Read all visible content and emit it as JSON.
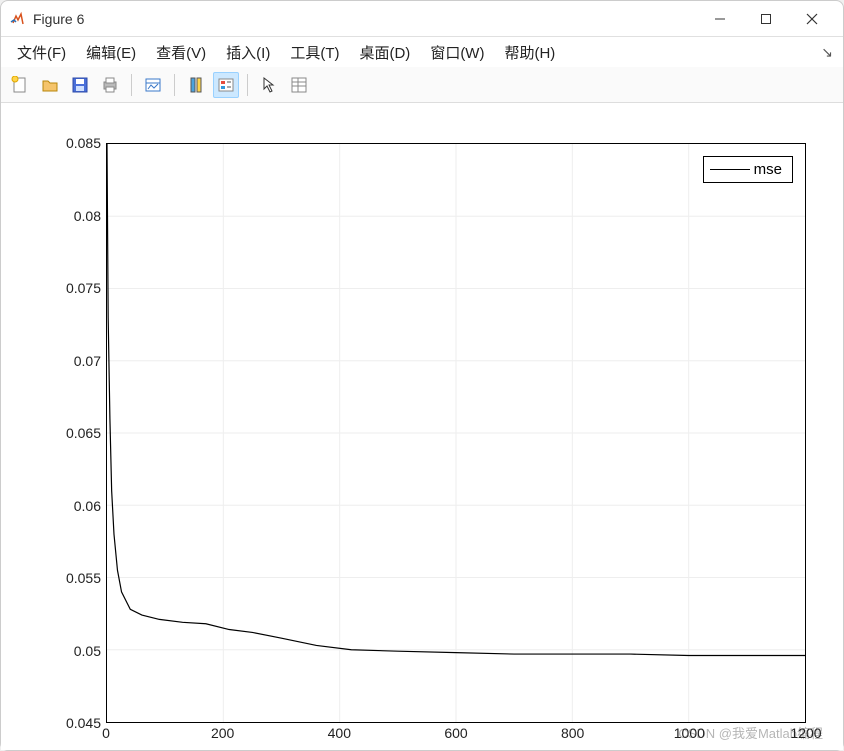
{
  "window": {
    "title": "Figure 6"
  },
  "menubar": {
    "items": [
      "文件(F)",
      "编辑(E)",
      "查看(V)",
      "插入(I)",
      "工具(T)",
      "桌面(D)",
      "窗口(W)",
      "帮助(H)"
    ]
  },
  "toolbar": {
    "new": "new-figure-icon",
    "open": "open-folder-icon",
    "save": "save-icon",
    "print": "print-icon",
    "link": "link-icon",
    "colorbar": "colorbar-icon",
    "legend": "legend-icon",
    "arrow": "arrow-icon",
    "property": "property-icon"
  },
  "chart_data": {
    "type": "line",
    "title": "",
    "xlabel": "",
    "ylabel": "",
    "xlim": [
      0,
      1200
    ],
    "ylim": [
      0.045,
      0.085
    ],
    "xticks": [
      0,
      200,
      400,
      600,
      800,
      1000,
      1200
    ],
    "yticks": [
      0.045,
      0.05,
      0.055,
      0.06,
      0.065,
      0.07,
      0.075,
      0.08,
      0.085
    ],
    "grid": true,
    "legend": {
      "position": "upper-right",
      "entries": [
        "mse"
      ]
    },
    "series": [
      {
        "name": "mse",
        "color": "#000000",
        "x": [
          0,
          2,
          5,
          8,
          12,
          18,
          25,
          40,
          60,
          90,
          130,
          170,
          210,
          250,
          300,
          360,
          420,
          500,
          600,
          700,
          800,
          900,
          1000,
          1100,
          1200
        ],
        "values": [
          0.085,
          0.073,
          0.066,
          0.061,
          0.058,
          0.0555,
          0.054,
          0.0528,
          0.0524,
          0.0521,
          0.0519,
          0.0518,
          0.0514,
          0.0512,
          0.0508,
          0.0503,
          0.05,
          0.0499,
          0.0498,
          0.0497,
          0.0497,
          0.0497,
          0.0496,
          0.0496,
          0.0496
        ]
      }
    ]
  },
  "watermark": "CSDN @我爱Matlab编程"
}
